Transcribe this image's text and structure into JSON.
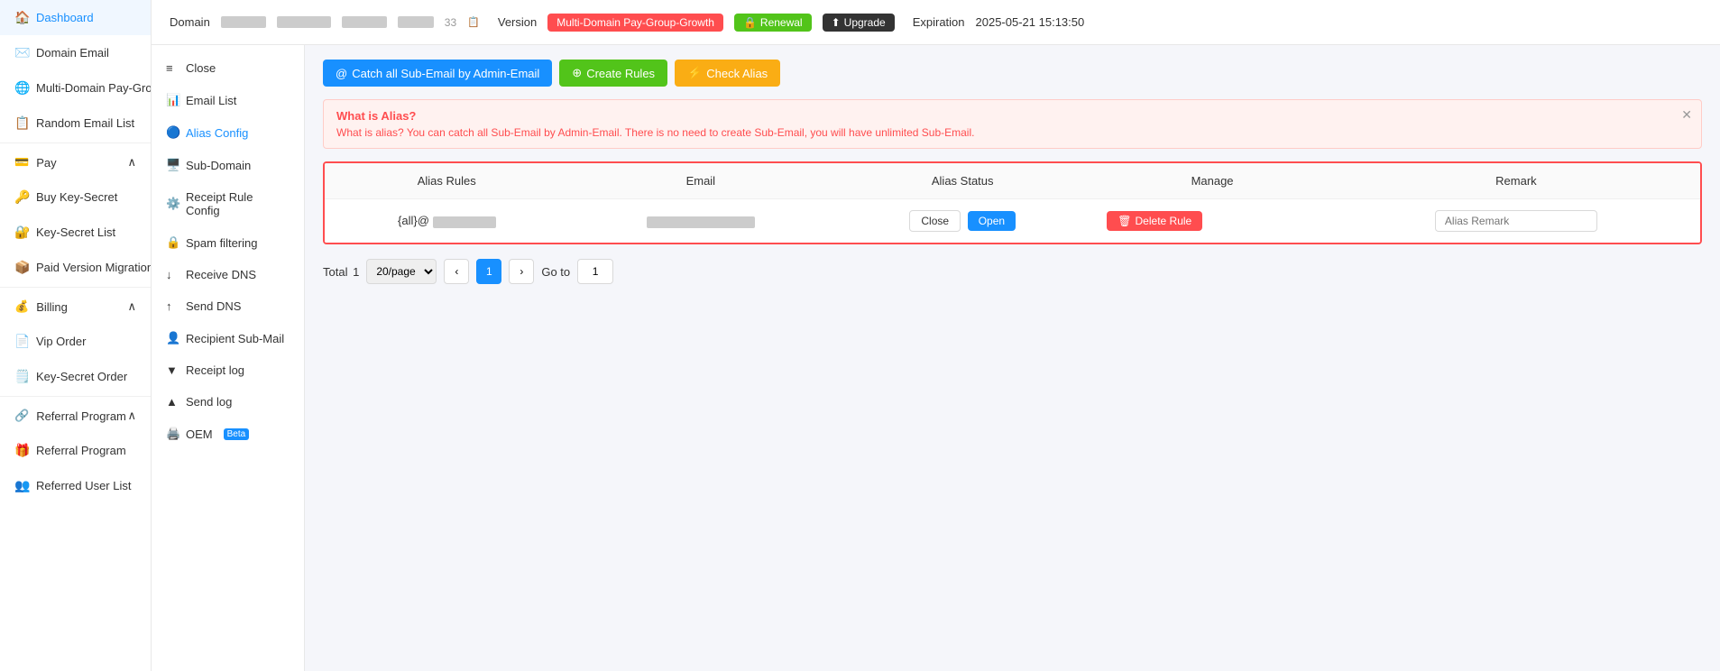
{
  "sidebar": {
    "items": [
      {
        "id": "dashboard",
        "label": "Dashboard",
        "icon": "🏠"
      },
      {
        "id": "domain-email",
        "label": "Domain Email",
        "icon": "✉️"
      },
      {
        "id": "multi-domain",
        "label": "Multi-Domain Pay-Group",
        "icon": "🌐"
      },
      {
        "id": "random-email",
        "label": "Random Email List",
        "icon": "📋"
      },
      {
        "id": "pay",
        "label": "Pay",
        "icon": "💳",
        "expandable": true
      },
      {
        "id": "buy-key-secret",
        "label": "Buy Key-Secret",
        "icon": "🔑"
      },
      {
        "id": "key-secret-list",
        "label": "Key-Secret List",
        "icon": "🔐"
      },
      {
        "id": "paid-version",
        "label": "Paid Version Migration",
        "icon": "📦"
      },
      {
        "id": "billing",
        "label": "Billing",
        "icon": "💰",
        "expandable": true
      },
      {
        "id": "vip-order",
        "label": "Vip Order",
        "icon": "📄"
      },
      {
        "id": "key-secret-order",
        "label": "Key-Secret Order",
        "icon": "🗒️"
      },
      {
        "id": "referral-program",
        "label": "Referral Program",
        "icon": "🔗",
        "expandable": true
      },
      {
        "id": "referral-program-item",
        "label": "Referral Program",
        "icon": "🎁"
      },
      {
        "id": "referred-user-list",
        "label": "Referred User List",
        "icon": "👥"
      }
    ]
  },
  "header": {
    "domain_label": "Domain",
    "version_label": "Version",
    "version_value": "Multi-Domain Pay-Group-Growth",
    "renewal_label": "Renewal",
    "upgrade_label": "Upgrade",
    "expiration_label": "Expiration",
    "expiration_value": "2025-05-21 15:13:50"
  },
  "secondary_sidebar": {
    "items": [
      {
        "id": "close",
        "label": "Close",
        "icon": "≡"
      },
      {
        "id": "email-list",
        "label": "Email List",
        "icon": "📊"
      },
      {
        "id": "alias-config",
        "label": "Alias Config",
        "icon": "🔵",
        "active": true
      },
      {
        "id": "sub-domain",
        "label": "Sub-Domain",
        "icon": "🖥️"
      },
      {
        "id": "receipt-rule-config",
        "label": "Receipt Rule Config",
        "icon": "⚙️"
      },
      {
        "id": "spam-filtering",
        "label": "Spam filtering",
        "icon": "🔒"
      },
      {
        "id": "receive-dns",
        "label": "Receive DNS",
        "icon": "↓"
      },
      {
        "id": "send-dns",
        "label": "Send DNS",
        "icon": "↑"
      },
      {
        "id": "recipient-sub-mail",
        "label": "Recipient Sub-Mail",
        "icon": "👤"
      },
      {
        "id": "receipt-log",
        "label": "Receipt log",
        "icon": "▼"
      },
      {
        "id": "send-log",
        "label": "Send log",
        "icon": "▲"
      },
      {
        "id": "oem",
        "label": "OEM",
        "badge": "Beta",
        "icon": "🖨️"
      }
    ]
  },
  "toolbar": {
    "catch_all_label": "Catch all Sub-Email by Admin-Email",
    "create_rules_label": "Create Rules",
    "check_alias_label": "Check Alias"
  },
  "alert": {
    "title": "What is Alias?",
    "description": "What is alias? You can catch all Sub-Email by Admin-Email. There is no need to create Sub-Email, you will have unlimited Sub-Email."
  },
  "table": {
    "columns": [
      "Alias Rules",
      "Email",
      "Alias Status",
      "Manage",
      "Remark"
    ],
    "rows": [
      {
        "alias_rules": "{all}@",
        "email": "",
        "alias_status_close": "Close",
        "alias_status_open": "Open",
        "remark_placeholder": "Alias Remark"
      }
    ]
  },
  "pagination": {
    "total_label": "Total",
    "total": 1,
    "per_page": "20/page",
    "current_page": 1,
    "goto_label": "Go to",
    "goto_value": "1"
  },
  "colors": {
    "red": "#ff4d4f",
    "blue": "#1890ff",
    "green": "#52c41a",
    "yellow": "#faad14",
    "dark": "#333"
  }
}
